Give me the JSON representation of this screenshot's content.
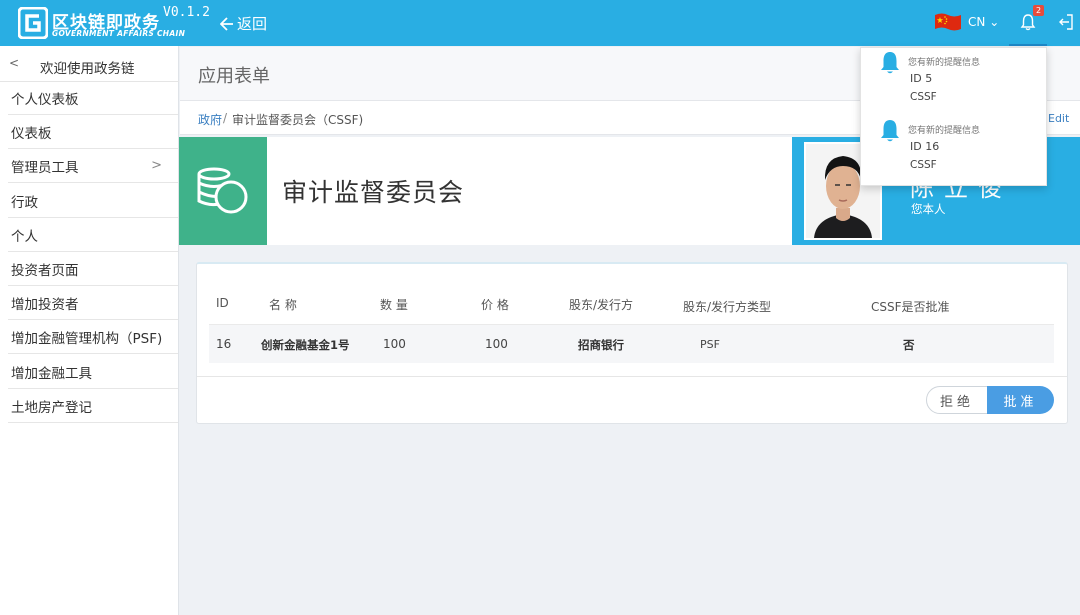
{
  "app": {
    "logo_title": "区块链即政务",
    "logo_subtitle": "GOVERNMENT AFFAIRS CHAIN",
    "version": "V0.1.2",
    "back_label": "返回",
    "lang": "CN",
    "notif_count": "2",
    "accent_color": "#29aee3",
    "icon_box_color": "#3fb28a"
  },
  "sidebar": {
    "header": "欢迎使用政务链",
    "items": [
      {
        "label": "个人仪表板"
      },
      {
        "label": "仪表板"
      },
      {
        "label": "管理员工具"
      },
      {
        "label": "行政"
      },
      {
        "label": "个人"
      },
      {
        "label": "投资者页面"
      },
      {
        "label": "增加投资者"
      },
      {
        "label": "增加金融管理机构（PSF)"
      },
      {
        "label": "增加金融工具"
      },
      {
        "label": "土地房产登记"
      }
    ]
  },
  "page": {
    "title": "应用表单",
    "breadcrumb": [
      "政府",
      "审计监督委员会（CSSF)"
    ],
    "edit_label": "Edit"
  },
  "banner": {
    "title": "审计监督委员会",
    "profile_name": "陈立俊",
    "profile_sub": "您本人"
  },
  "notifications": [
    {
      "heading": "您有新的提醒信息",
      "id": "ID 5",
      "type": "CSSF"
    },
    {
      "heading": "您有新的提醒信息",
      "id": "ID 16",
      "type": "CSSF"
    }
  ],
  "table": {
    "headers": [
      "ID",
      "名 称",
      "数 量",
      "价 格",
      "股东/发行方",
      "股东/发行方类型",
      "CSSF是否批准"
    ],
    "rows": [
      [
        "16",
        "创新金融基金1号",
        "100",
        "100",
        "招商银行",
        "PSF",
        "否"
      ]
    ]
  },
  "actions": {
    "reject": "拒绝",
    "approve": "批准"
  }
}
